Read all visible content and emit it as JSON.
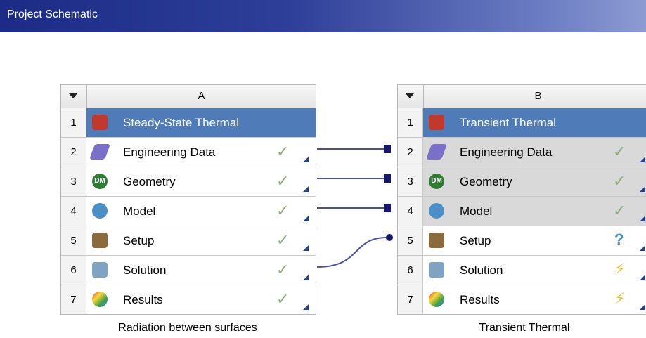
{
  "window": {
    "title": "Project Schematic"
  },
  "systems": [
    {
      "letter": "A",
      "caption": "Radiation between surfaces",
      "rows": [
        {
          "num": "1",
          "label": "Steady-State Thermal",
          "icon": "thermometer-icon",
          "status": ""
        },
        {
          "num": "2",
          "label": "Engineering Data",
          "icon": "book-icon",
          "status": "✓"
        },
        {
          "num": "3",
          "label": "Geometry",
          "icon": "dm-icon",
          "status": "✓"
        },
        {
          "num": "4",
          "label": "Model",
          "icon": "mesh-icon",
          "status": "✓"
        },
        {
          "num": "5",
          "label": "Setup",
          "icon": "setup-icon",
          "status": "✓"
        },
        {
          "num": "6",
          "label": "Solution",
          "icon": "solution-icon",
          "status": "✓"
        },
        {
          "num": "7",
          "label": "Results",
          "icon": "results-icon",
          "status": "✓"
        }
      ]
    },
    {
      "letter": "B",
      "caption": "Transient Thermal",
      "rows": [
        {
          "num": "1",
          "label": "Transient Thermal",
          "icon": "thermometer-clock-icon",
          "status": ""
        },
        {
          "num": "2",
          "label": "Engineering Data",
          "icon": "book-icon",
          "status": "✓"
        },
        {
          "num": "3",
          "label": "Geometry",
          "icon": "dm-icon",
          "status": "✓"
        },
        {
          "num": "4",
          "label": "Model",
          "icon": "mesh-icon",
          "status": "✓"
        },
        {
          "num": "5",
          "label": "Setup",
          "icon": "setup-icon",
          "status": "?"
        },
        {
          "num": "6",
          "label": "Solution",
          "icon": "solution-icon",
          "status": "⚡"
        },
        {
          "num": "7",
          "label": "Results",
          "icon": "results-icon",
          "status": "⚡"
        }
      ]
    }
  ],
  "colors": {
    "title_row": "#4f7bb9",
    "link": "#4b4fa0",
    "link_node": "#15186b",
    "check": "#8fa97a",
    "question": "#4a8ed0",
    "bolt": "#e2c02a"
  }
}
